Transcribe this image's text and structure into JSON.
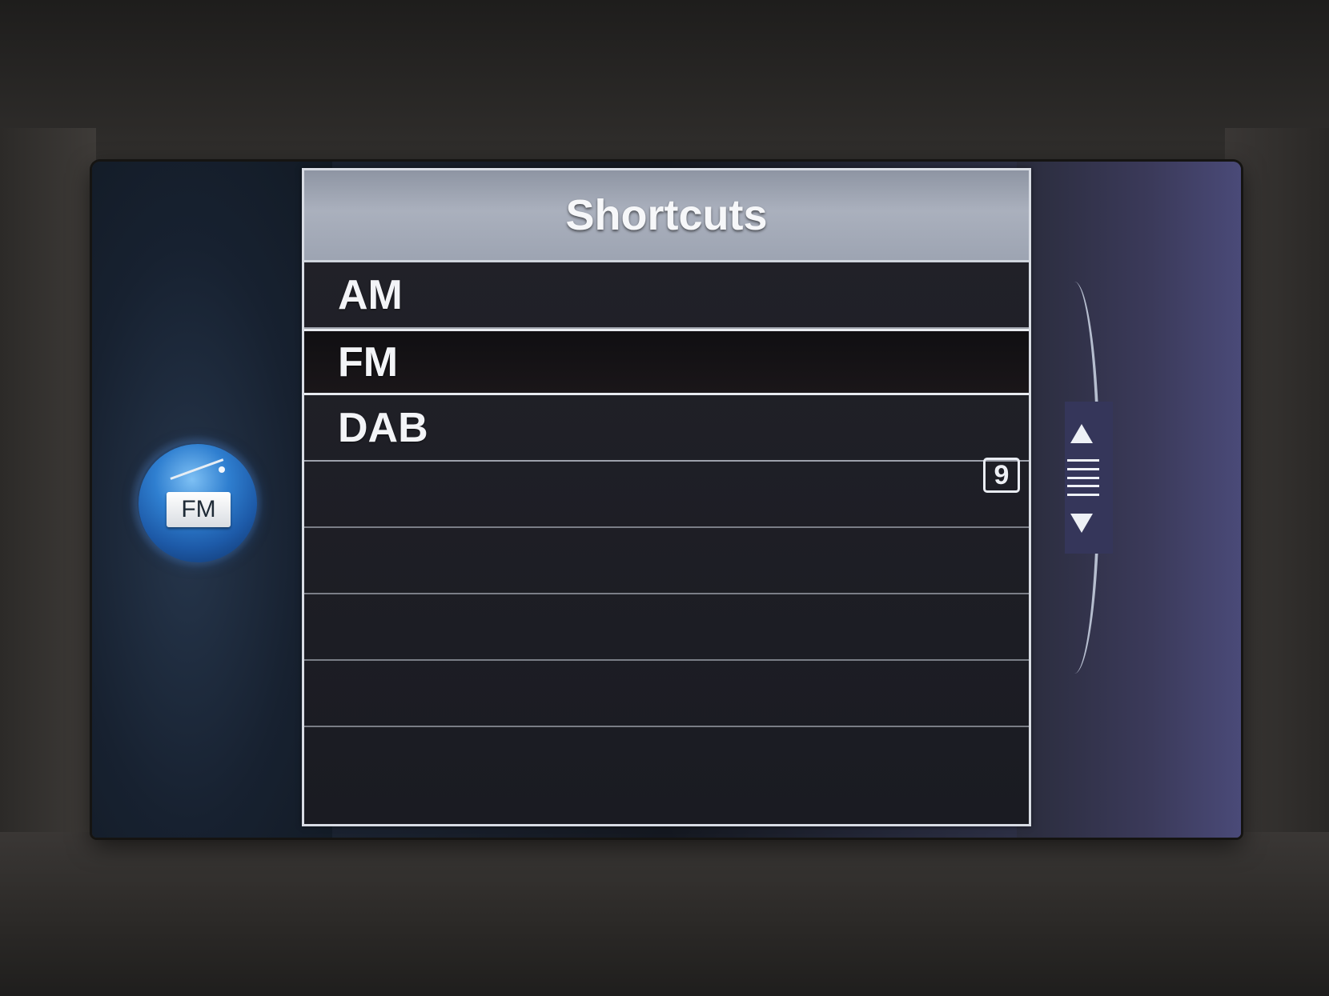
{
  "menu": {
    "title": "Shortcuts",
    "items": [
      {
        "label": "AM",
        "selected": false
      },
      {
        "label": "FM",
        "selected": true
      },
      {
        "label": "DAB",
        "selected": false
      }
    ]
  },
  "source": {
    "label": "FM",
    "icon": "radio-icon"
  },
  "counter": {
    "value": "9"
  },
  "colors": {
    "header": "#a4abb8",
    "panel": "#1e1f26",
    "orb": "#2f7fd0",
    "text": "#f3f4f7"
  }
}
